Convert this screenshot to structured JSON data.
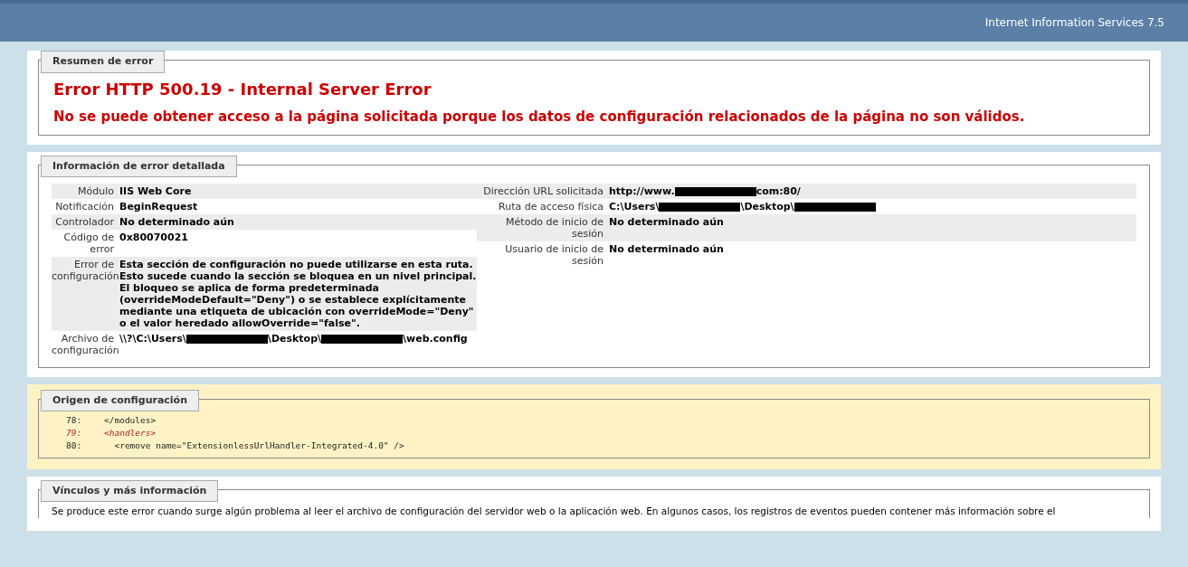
{
  "header": {
    "product": "Internet Information Services 7.5"
  },
  "summary": {
    "legend": "Resumen de error",
    "title": "Error HTTP 500.19 - Internal Server Error",
    "message": "No se puede obtener acceso a la página solicitada porque los datos de configuración relacionados de la página no son válidos."
  },
  "details": {
    "legend": "Información de error detallada",
    "left_rows": [
      {
        "label": "Módulo",
        "value": [
          {
            "kind": "text",
            "text": "IIS Web Core"
          }
        ]
      },
      {
        "label": "Notificación",
        "value": [
          {
            "kind": "text",
            "text": "BeginRequest"
          }
        ]
      },
      {
        "label": "Controlador",
        "value": [
          {
            "kind": "text",
            "text": "No determinado aún"
          }
        ]
      },
      {
        "label": "Código de error",
        "value": [
          {
            "kind": "text",
            "text": "0x80070021"
          }
        ]
      },
      {
        "label": "Error de configuración",
        "value": [
          {
            "kind": "text",
            "text": "Esta sección de configuración no puede utilizarse en esta ruta. Esto sucede cuando la sección se bloquea en un nivel principal. El bloqueo se aplica de forma predeterminada (overrideModeDefault=\"Deny\") o se establece explícitamente mediante una etiqueta de ubicación con overrideMode=\"Deny\" o el valor heredado allowOverride=\"false\"."
          }
        ]
      },
      {
        "label": "Archivo de configuración",
        "value": [
          {
            "kind": "text",
            "text": "\\\\?\\C:\\Users\\"
          },
          {
            "kind": "redacted"
          },
          {
            "kind": "text",
            "text": "\\Desktop\\"
          },
          {
            "kind": "redacted"
          },
          {
            "kind": "text",
            "text": "\\web.config"
          }
        ]
      }
    ],
    "right_rows": [
      {
        "label": "Dirección URL solicitada",
        "value": [
          {
            "kind": "text",
            "text": "http://www."
          },
          {
            "kind": "redacted"
          },
          {
            "kind": "text",
            "text": "com:80/"
          }
        ]
      },
      {
        "label": "Ruta de acceso física",
        "value": [
          {
            "kind": "text",
            "text": "C:\\Users\\"
          },
          {
            "kind": "redacted"
          },
          {
            "kind": "text",
            "text": "\\Desktop\\"
          },
          {
            "kind": "redacted"
          }
        ]
      },
      {
        "label": "Método de inicio de sesión",
        "value": [
          {
            "kind": "text",
            "text": "No determinado aún"
          }
        ]
      },
      {
        "label": "Usuario de inicio de sesión",
        "value": [
          {
            "kind": "text",
            "text": "No determinado aún"
          }
        ]
      }
    ]
  },
  "config_source": {
    "legend": "Origen de configuración",
    "lines": [
      {
        "number": "78:",
        "code": "</modules>",
        "highlighted": false
      },
      {
        "number": "79:",
        "code": "<handlers>",
        "highlighted": true
      },
      {
        "number": "80:",
        "code": "  <remove name=\"ExtensionlessUrlHandler-Integrated-4.0\" />",
        "highlighted": false
      }
    ]
  },
  "links": {
    "legend": "Vínculos y más información",
    "text": "Se produce este error cuando surge algún problema al leer el archivo de configuración del servidor web o la aplicación web. En algunos casos, los registros de eventos pueden contener más información sobre el"
  }
}
